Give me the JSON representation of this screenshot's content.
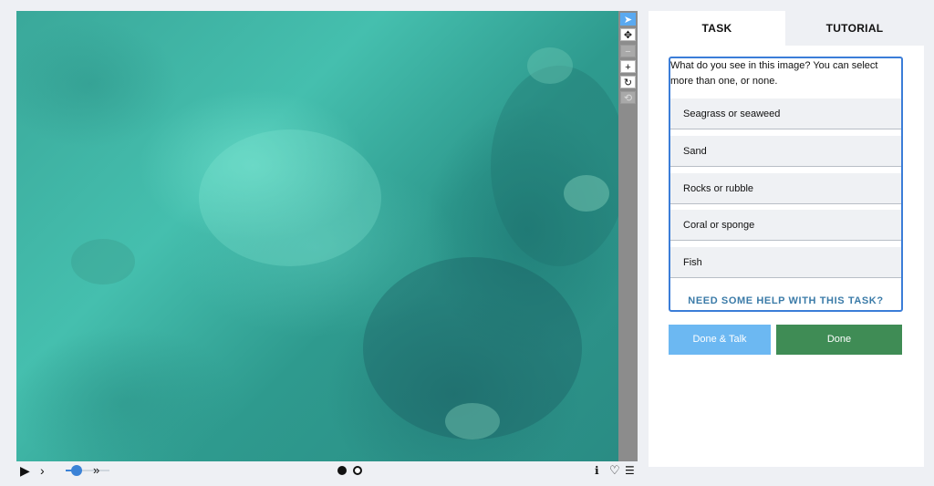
{
  "toolbar": {
    "tools": [
      {
        "name": "select-tool",
        "icon": "arrow-pointer-icon",
        "glyph": "➤",
        "state": "active"
      },
      {
        "name": "pan-tool",
        "icon": "move-arrows-icon",
        "glyph": "✥",
        "state": "normal"
      },
      {
        "name": "zoom-out-tool",
        "icon": "minus-icon",
        "glyph": "−",
        "state": "disabled"
      },
      {
        "name": "zoom-in-tool",
        "icon": "plus-icon",
        "glyph": "+",
        "state": "normal"
      },
      {
        "name": "rotate-tool",
        "icon": "rotate-icon",
        "glyph": "↻",
        "state": "normal"
      },
      {
        "name": "reset-tool",
        "icon": "reset-icon",
        "glyph": "⟲",
        "state": "disabled"
      }
    ]
  },
  "controls": {
    "play_glyph": "▶",
    "prev_glyph": "›",
    "next_glyph": "»",
    "playback_speed_fraction": 0.25,
    "info_glyph": "ℹ",
    "favorite_glyph": "♡",
    "collections_glyph": "☰"
  },
  "tabs": {
    "task": "TASK",
    "tutorial": "TUTORIAL"
  },
  "task": {
    "question": "What do you see in this image? You can select more than one, or none.",
    "answers": [
      "Seagrass or seaweed",
      "Sand",
      "Rocks or rubble",
      "Coral or sponge",
      "Fish"
    ],
    "help_link": "NEED SOME HELP WITH THIS TASK?",
    "done_talk_label": "Done & Talk",
    "done_label": "Done"
  },
  "colors": {
    "accent_blue": "#3b7dd8",
    "done_green": "#3f8c55",
    "done_talk_blue": "#6cb8f2"
  }
}
